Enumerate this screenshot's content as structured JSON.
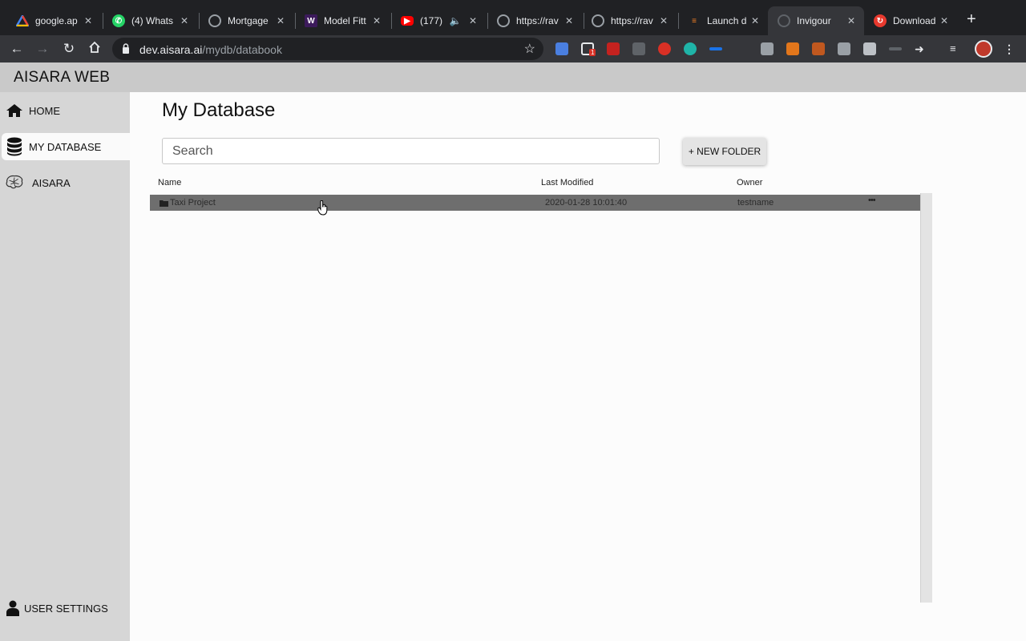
{
  "browser": {
    "tabs": [
      {
        "title": "google.ap",
        "favicon": "google-cloud-icon",
        "active": false
      },
      {
        "title": "(4) Whats",
        "favicon": "whatsapp-icon",
        "active": false
      },
      {
        "title": "Mortgage",
        "favicon": "globe-icon",
        "active": false
      },
      {
        "title": "Model Fitt",
        "favicon": "w-icon",
        "active": false
      },
      {
        "title": "(177)",
        "favicon": "youtube-icon",
        "active": false
      },
      {
        "title": "https://rav",
        "favicon": "globe-icon",
        "active": false
      },
      {
        "title": "https://rav",
        "favicon": "globe-icon",
        "active": false
      },
      {
        "title": "Launch d",
        "favicon": "stack-icon",
        "active": false
      },
      {
        "title": "Invigour",
        "favicon": "globe-icon",
        "active": true
      },
      {
        "title": "Download",
        "favicon": "download-icon",
        "active": false
      }
    ],
    "url_host": "dev.aisara.ai",
    "url_path": "/mydb/databook",
    "extension_badge": "1"
  },
  "app": {
    "title": "AISARA WEB"
  },
  "sidebar": {
    "items": [
      {
        "label": "HOME",
        "icon": "home-icon"
      },
      {
        "label": "MY DATABASE",
        "icon": "database-icon"
      },
      {
        "label": "AISARA",
        "icon": "brain-icon"
      }
    ],
    "user_settings": "USER SETTINGS"
  },
  "main": {
    "title": "My Database",
    "search_placeholder": "Search",
    "new_folder_label": "+ NEW FOLDER",
    "columns": {
      "name": "Name",
      "modified": "Last Modified",
      "owner": "Owner"
    },
    "rows": [
      {
        "name": "Taxi Project",
        "modified": "2020-01-28 10:01:40",
        "owner": "testname",
        "menu": "•••"
      }
    ]
  },
  "colors": {
    "appbar": "#c9c9c9",
    "sidebar": "#d6d6d6",
    "selected_row": "#6e6e6e",
    "chrome_dark": "#202124"
  }
}
